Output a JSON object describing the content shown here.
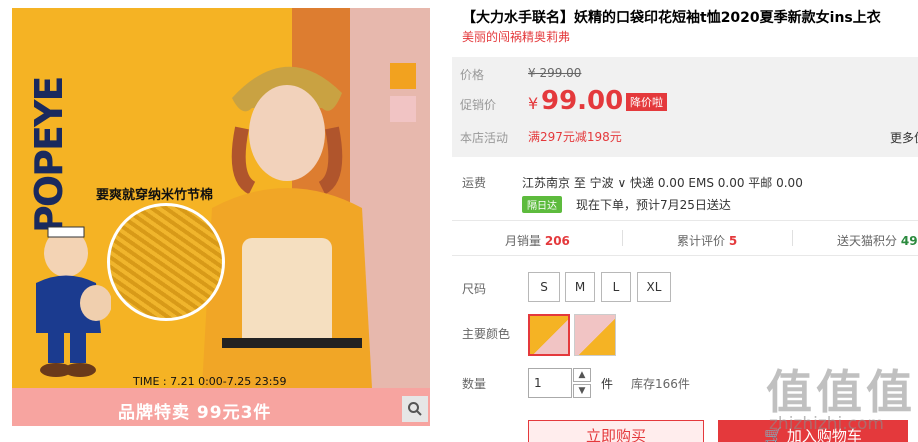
{
  "gallery": {
    "brand": "POPEYE",
    "fabric_caption": "要爽就穿纳米竹节棉",
    "time": "TIME : 7.21 0:00-7.25 23:59",
    "promo": "品牌特卖  99元3件",
    "search_icon": "search-icon",
    "colors": {
      "yellow": "#f2a21f",
      "pink": "#f1c4c4"
    }
  },
  "product": {
    "title": "【大力水手联名】妖精的口袋印花短袖t恤2020夏季新款女ins上衣",
    "shop_tagline": "美丽的闯祸精奥莉弗"
  },
  "price": {
    "orig_label": "价格",
    "orig": "¥ 299.00",
    "cur_label": "促销价",
    "yen": "¥",
    "cur": "99.00",
    "badge": "降价啦",
    "promo_label": "本店活动",
    "promo_val": "满297元减198元",
    "more": "更多优惠",
    "accent": "#e4393c"
  },
  "shipping": {
    "label": "运费",
    "route": "江苏南京  至  宁波 ∨  快递 0.00 EMS 0.00 平邮 0.00",
    "badge": "隔日达",
    "note": "现在下单，预计7月25日送达"
  },
  "stats": {
    "sales_label": "月销量",
    "sales": "206",
    "reviews_label": "累计评价",
    "reviews": "5",
    "points_label": "送天猫积分",
    "points": "49"
  },
  "options": {
    "size_label": "尺码",
    "sizes": [
      "S",
      "M",
      "L",
      "XL"
    ],
    "color_label": "主要颜色",
    "qty_label": "数量",
    "qty": "1",
    "qty_unit": "件",
    "stock": "库存166件"
  },
  "actions": {
    "buy": "立即购买",
    "cart": "加入购物车"
  },
  "watermark": {
    "chars": [
      "值",
      "值",
      "值"
    ],
    "url": "zhizhizhi.com"
  }
}
